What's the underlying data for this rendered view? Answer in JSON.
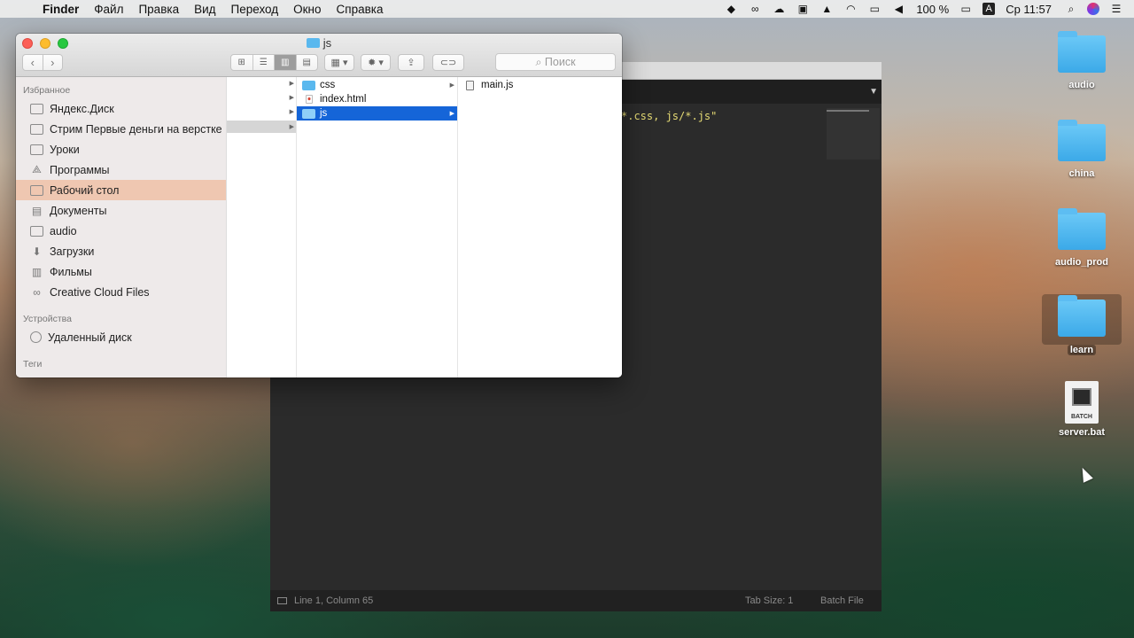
{
  "menubar": {
    "app": "Finder",
    "items": [
      "Файл",
      "Правка",
      "Вид",
      "Переход",
      "Окно",
      "Справка"
    ],
    "battery": "100 %",
    "input_lang": "A",
    "clock": "Ср 11:57"
  },
  "editor": {
    "code_line": "*.css, js/*.js\"",
    "status": {
      "position": "Line 1, Column 65",
      "tab_size": "Tab Size: 1",
      "syntax": "Batch File"
    }
  },
  "desktop": {
    "icons": [
      {
        "label": "audio"
      },
      {
        "label": "china"
      },
      {
        "label": "audio_prod"
      },
      {
        "label": "learn"
      },
      {
        "label": "server.bat",
        "badge": "BATCH"
      }
    ]
  },
  "finder": {
    "title": "js",
    "search_placeholder": "Поиск",
    "sidebar": {
      "favorites_header": "Избранное",
      "favorites": [
        {
          "label": "Яндекс.Диск",
          "icon": "folder-icon"
        },
        {
          "label": "Стрим Первые деньги на верстке",
          "icon": "folder-icon"
        },
        {
          "label": "Уроки",
          "icon": "folder-icon"
        },
        {
          "label": "Программы",
          "icon": "applications-icon"
        },
        {
          "label": "Рабочий стол",
          "icon": "desktop-icon",
          "selected": true
        },
        {
          "label": "Документы",
          "icon": "documents-icon"
        },
        {
          "label": "audio",
          "icon": "folder-icon"
        },
        {
          "label": "Загрузки",
          "icon": "downloads-icon"
        },
        {
          "label": "Фильмы",
          "icon": "movies-icon"
        },
        {
          "label": "Creative Cloud Files",
          "icon": "creative-cloud-icon"
        }
      ],
      "devices_header": "Устройства",
      "devices": [
        {
          "label": "Удаленный диск",
          "icon": "remote-disc-icon"
        }
      ],
      "tags_header": "Теги"
    },
    "column1": [
      {
        "name": "css",
        "type": "folder"
      },
      {
        "name": "index.html",
        "type": "html"
      },
      {
        "name": "js",
        "type": "folder",
        "selected": true
      }
    ],
    "column2": [
      {
        "name": "main.js",
        "type": "js"
      }
    ]
  }
}
